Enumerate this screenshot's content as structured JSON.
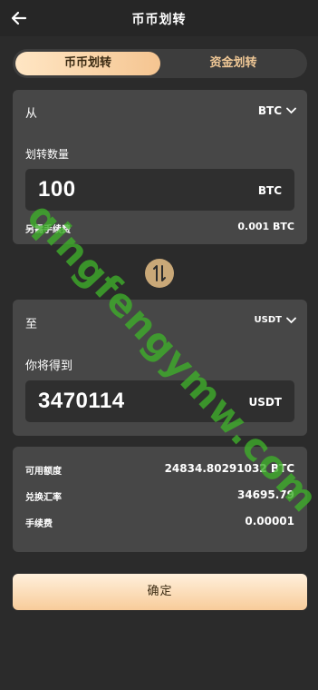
{
  "header": {
    "title": "币币划转"
  },
  "tabs": [
    {
      "label": "币币划转",
      "active": true
    },
    {
      "label": "资金划转",
      "active": false
    }
  ],
  "from": {
    "label": "从",
    "coin": "BTC",
    "amount_label": "划转数量",
    "amount": "100",
    "amount_unit": "BTC",
    "fee_label": "另需手续费",
    "fee_value": "0.001 BTC"
  },
  "to": {
    "label": "至",
    "coin": "USDT",
    "receive_label": "你将得到",
    "receive_amount": "3470114",
    "receive_unit": "USDT"
  },
  "info": {
    "available_label": "可用额度",
    "available_value": "24834.80291032 BTC",
    "rate_label": "兑换汇率",
    "rate_value": "34695.79",
    "fee_label": "手续费",
    "fee_value": "0.00001"
  },
  "confirm_label": "确定",
  "watermark": "qingfengymw.com",
  "colors": {
    "accent": "#f5c591",
    "background": "#2b2b2b",
    "card": "#474747",
    "watermark": "#3fae2a"
  }
}
